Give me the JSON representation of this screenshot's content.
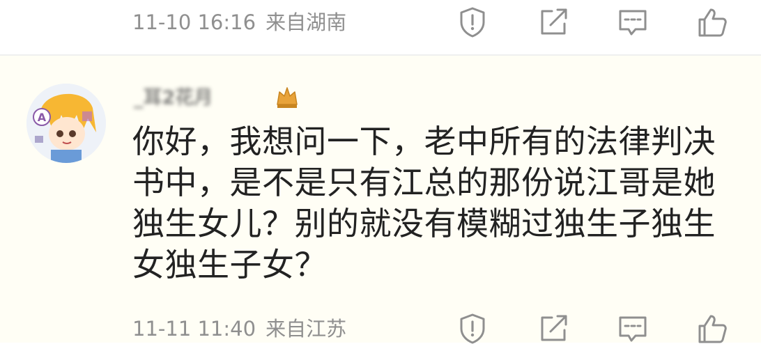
{
  "previous_comment": {
    "timestamp": "11-10 16:16",
    "location": "来自湖南"
  },
  "comment": {
    "username": "_耳2花月",
    "text": "你好，我想问一下，老中所有的法律判决书中，是不是只有江总的那份说江哥是她独生女儿？别的就没有模糊过独生子独生女独生子女？",
    "timestamp": "11-11 11:40",
    "location": "来自江苏"
  },
  "actions": {
    "report_icon": "report-icon",
    "share_icon": "share-icon",
    "reply_icon": "comment-icon",
    "like_icon": "thumbs-up-icon"
  },
  "colors": {
    "meta_text": "#8f8f8f",
    "icon_stroke": "#8f8f8f",
    "comment_text": "#222222",
    "card_background": "#fffef5",
    "badge_gold": "#e8a33a"
  }
}
